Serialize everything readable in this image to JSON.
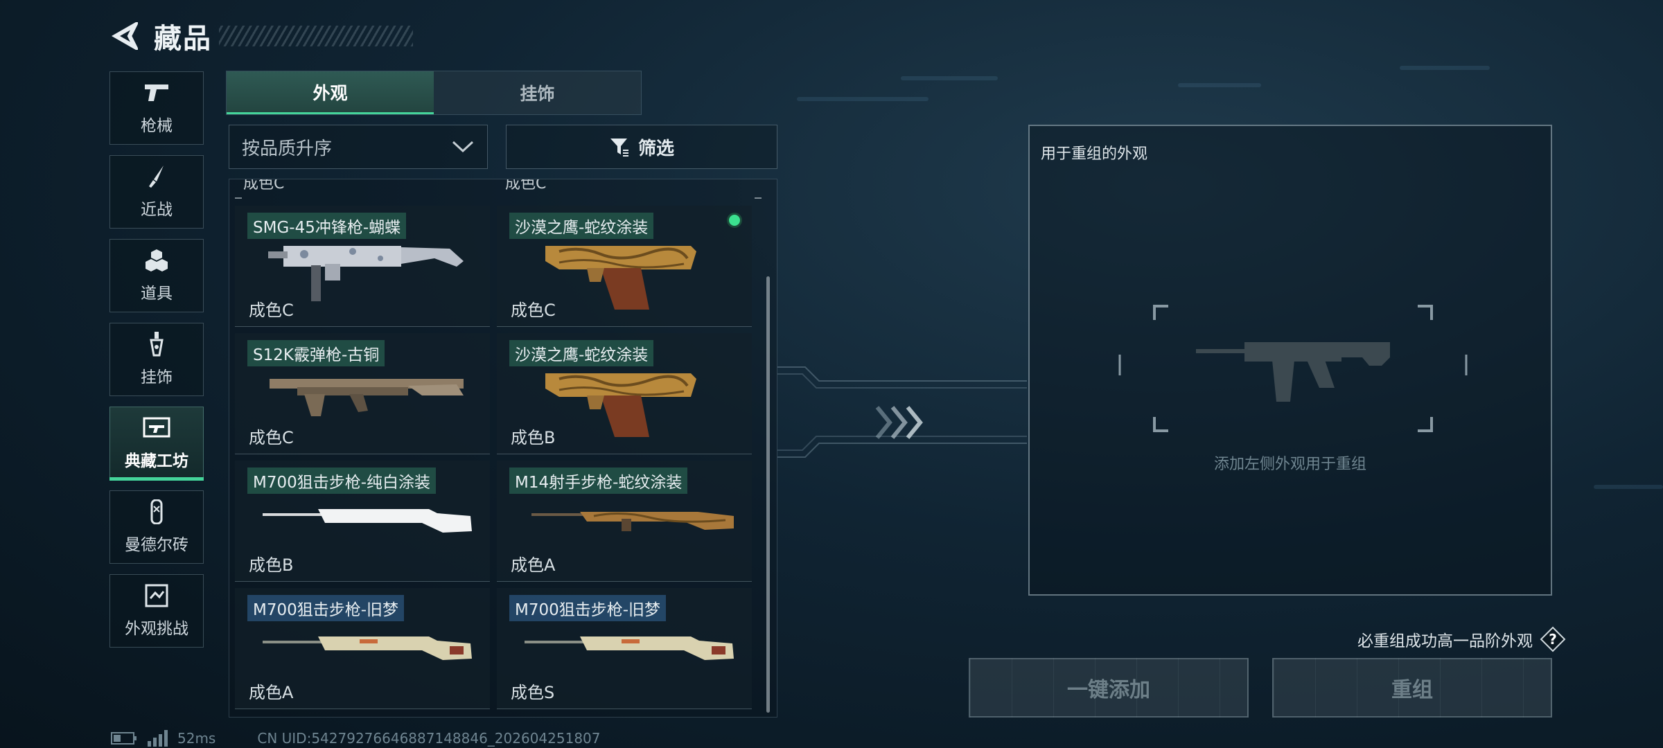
{
  "header": {
    "title": "藏品",
    "back_icon": "back-arrow-icon"
  },
  "sidenav": {
    "items": [
      {
        "label": "枪械",
        "icon": "pistol-icon",
        "active": false
      },
      {
        "label": "近战",
        "icon": "knife-icon",
        "active": false
      },
      {
        "label": "道具",
        "icon": "grenade-icon",
        "active": false
      },
      {
        "label": "挂饰",
        "icon": "charm-icon",
        "active": false
      },
      {
        "label": "典藏工坊",
        "icon": "workshop-icon",
        "active": true
      },
      {
        "label": "曼德尔砖",
        "icon": "brick-icon",
        "active": false
      },
      {
        "label": "外观挑战",
        "icon": "challenge-icon",
        "active": false
      }
    ]
  },
  "tabs": [
    {
      "label": "外观",
      "active": true
    },
    {
      "label": "挂饰",
      "active": false
    }
  ],
  "sort": {
    "value": "按品质升序"
  },
  "filter": {
    "label": "筛选"
  },
  "grid": {
    "partial_top": [
      "成色C",
      "成色C"
    ],
    "items": [
      {
        "name": "SMG-45冲锋枪-蝴蝶",
        "grade": "成色C",
        "tag": "green",
        "gun": "smg",
        "selected": false
      },
      {
        "name": "沙漠之鹰-蛇纹涂装",
        "grade": "成色C",
        "tag": "green",
        "gun": "pistol",
        "selected": true
      },
      {
        "name": "S12K霰弹枪-古铜",
        "grade": "成色C",
        "tag": "green",
        "gun": "shotgun",
        "selected": false
      },
      {
        "name": "沙漠之鹰-蛇纹涂装",
        "grade": "成色B",
        "tag": "green",
        "gun": "pistol",
        "selected": false
      },
      {
        "name": "M700狙击步枪-纯白涂装",
        "grade": "成色B",
        "tag": "green",
        "gun": "sniper-white",
        "selected": false
      },
      {
        "name": "M14射手步枪-蛇纹涂装",
        "grade": "成色A",
        "tag": "green",
        "gun": "rifle-snake",
        "selected": false
      },
      {
        "name": "M700狙击步枪-旧梦",
        "grade": "成色A",
        "tag": "blue",
        "gun": "sniper-dream",
        "selected": false
      },
      {
        "name": "M700狙击步枪-旧梦",
        "grade": "成色S",
        "tag": "blue",
        "gun": "sniper-dream",
        "selected": false
      }
    ]
  },
  "preview": {
    "title": "用于重组的外观",
    "hint": "添加左侧外观用于重组"
  },
  "note": {
    "text": "必重组成功高一品阶外观",
    "icon": "help-icon"
  },
  "buttons": {
    "add_all": "一键添加",
    "recombine": "重组"
  },
  "status": {
    "ping": "52ms",
    "uid": "CN UID:54279276646887148846_202604251807"
  },
  "colors": {
    "accent": "#45d49a",
    "selected_dot": "#3be08f"
  }
}
